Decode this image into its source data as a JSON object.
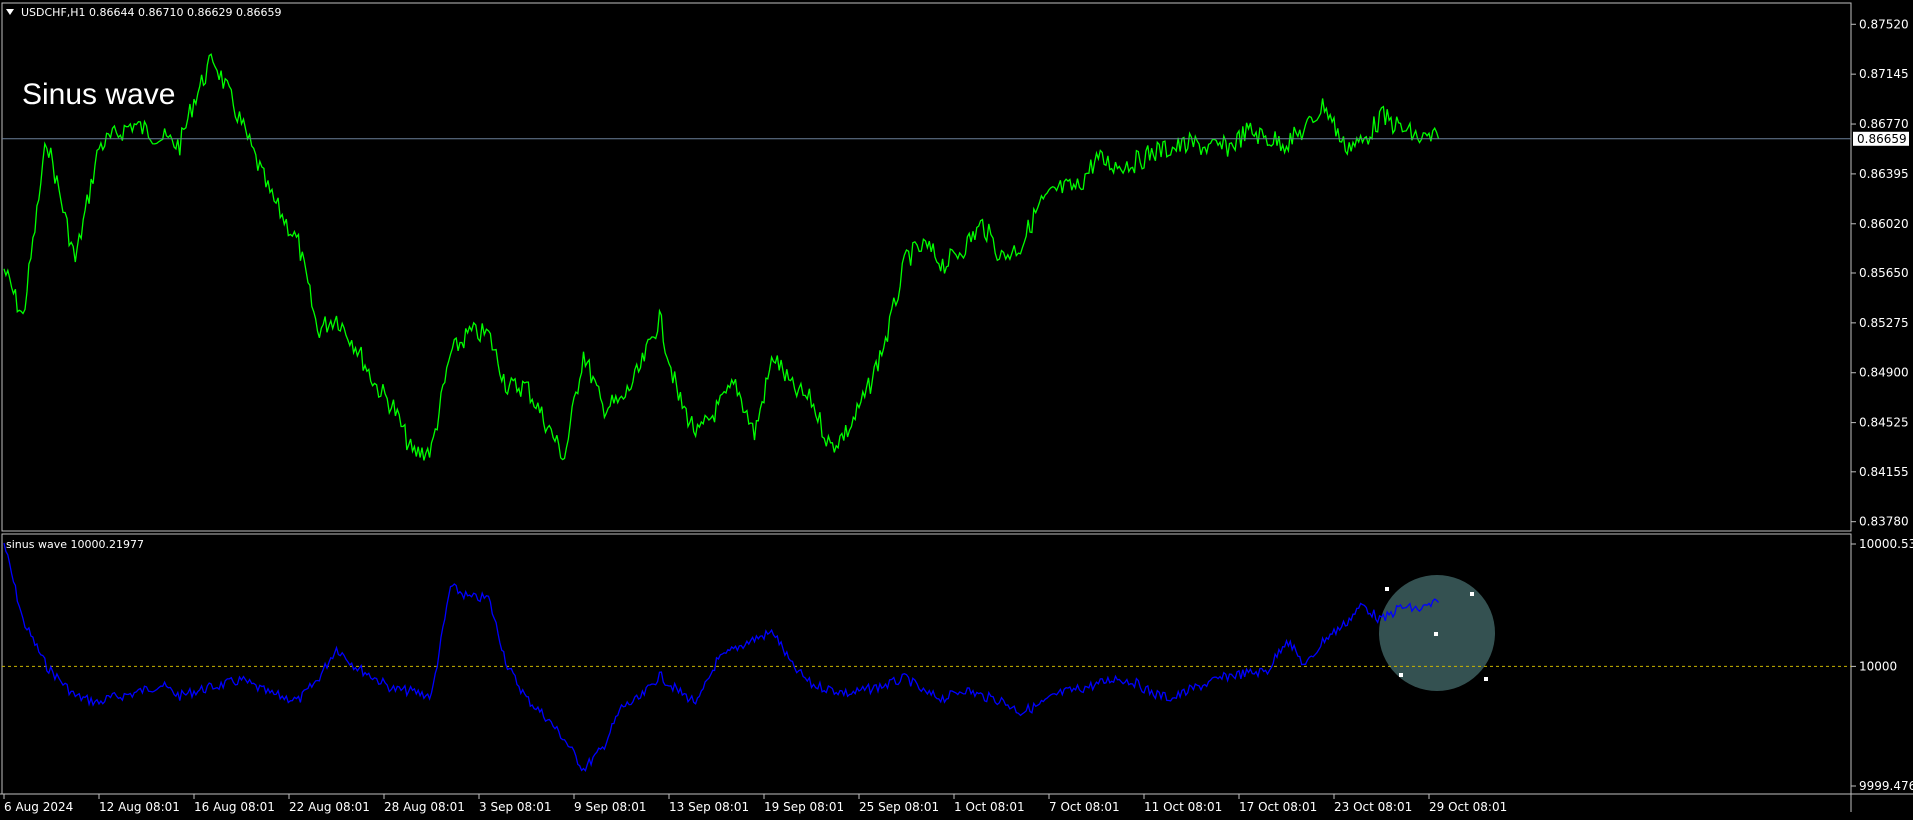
{
  "header": {
    "symbol_line": "USDCHF,H1  0.86644 0.86710 0.86629 0.86659",
    "arrow_icon": "triangle-down-icon"
  },
  "annotation_text": "Sinus wave",
  "current_price_label": "0.86659",
  "indicator": {
    "label": "sinus wave 10000.21977",
    "color": "#0000ff",
    "level_color": "#c8b400",
    "highlight_color": "#3a5a5a"
  },
  "colors": {
    "price": "#00ff00",
    "background": "#000000",
    "text": "#ffffff",
    "priceline": "#6a7f99"
  },
  "chart_data": [
    {
      "type": "line",
      "title": "USDCHF,H1",
      "y_ticks": [
        "0.87520",
        "0.87145",
        "0.86770",
        "0.86395",
        "0.86020",
        "0.85650",
        "0.85275",
        "0.84900",
        "0.84525",
        "0.84155",
        "0.83780"
      ],
      "ylim": [
        0.8371,
        0.8768
      ],
      "x_labels": [
        "6 Aug 2024",
        "12 Aug 08:01",
        "16 Aug 08:01",
        "22 Aug 08:01",
        "28 Aug 08:01",
        "3 Sep 08:01",
        "9 Sep 08:01",
        "13 Sep 08:01",
        "19 Sep 08:01",
        "25 Sep 08:01",
        "1 Oct 08:01",
        "7 Oct 08:01",
        "11 Oct 08:01",
        "17 Oct 08:01",
        "23 Oct 08:01",
        "29 Oct 08:01"
      ],
      "series": [
        {
          "x": [
            0,
            0.2,
            0.45,
            0.75,
            1.0,
            1.1,
            1.35,
            1.65,
            1.85,
            2.0,
            2.2,
            2.5,
            2.8,
            3.1,
            3.3,
            3.5,
            3.7,
            3.9,
            4.1,
            4.3,
            4.5,
            4.7,
            4.9,
            5.1,
            5.3,
            5.5,
            5.7,
            5.9,
            6.1,
            6.3,
            6.5,
            6.7,
            6.9,
            7.1,
            7.3,
            7.5,
            7.7,
            7.9,
            8.1,
            8.3,
            8.5,
            8.7,
            8.9,
            9.1,
            9.3,
            9.5,
            9.7,
            9.9,
            10.1,
            10.3,
            10.5,
            10.7,
            10.9,
            11.1,
            11.3,
            11.5,
            11.7,
            11.9,
            12.1,
            12.3,
            12.5,
            12.7,
            12.9,
            13.1,
            13.3,
            13.5,
            13.7,
            13.9,
            14.1,
            14.3,
            14.5,
            14.7,
            14.9,
            15.1
          ],
          "values": [
            0.8568,
            0.8531,
            0.8666,
            0.8574,
            0.866,
            0.8665,
            0.8677,
            0.8667,
            0.8661,
            0.8695,
            0.8727,
            0.8677,
            0.8624,
            0.8587,
            0.8522,
            0.8532,
            0.8511,
            0.8482,
            0.8464,
            0.8429,
            0.8432,
            0.8504,
            0.852,
            0.8519,
            0.8479,
            0.848,
            0.8453,
            0.8426,
            0.8505,
            0.8464,
            0.8468,
            0.8493,
            0.8531,
            0.8471,
            0.8443,
            0.8462,
            0.8482,
            0.8444,
            0.8503,
            0.8478,
            0.8469,
            0.8434,
            0.8448,
            0.8478,
            0.8519,
            0.8577,
            0.8585,
            0.8571,
            0.8584,
            0.8602,
            0.8577,
            0.8585,
            0.8616,
            0.8628,
            0.8629,
            0.8651,
            0.8646,
            0.8648,
            0.8656,
            0.8659,
            0.8662,
            0.8659,
            0.866,
            0.8672,
            0.8666,
            0.8663,
            0.8673,
            0.8692,
            0.8661,
            0.8663,
            0.8683,
            0.8674,
            0.8666,
            0.8666
          ]
        }
      ]
    },
    {
      "type": "line",
      "title": "sinus wave 10000.21977",
      "y_ticks": [
        "10000.536",
        "10000",
        "9999.4761"
      ],
      "ylim": [
        9999.4761,
        10000.536
      ],
      "series": [
        {
          "x": [
            0,
            0.2,
            0.45,
            0.75,
            1.0,
            1.1,
            1.35,
            1.65,
            1.85,
            2.0,
            2.2,
            2.5,
            2.8,
            3.1,
            3.3,
            3.5,
            3.7,
            3.9,
            4.1,
            4.3,
            4.5,
            4.7,
            4.9,
            5.1,
            5.3,
            5.5,
            5.7,
            5.9,
            6.1,
            6.3,
            6.5,
            6.7,
            6.9,
            7.1,
            7.3,
            7.5,
            7.7,
            7.9,
            8.1,
            8.3,
            8.5,
            8.7,
            8.9,
            9.1,
            9.3,
            9.5,
            9.7,
            9.9,
            10.1,
            10.3,
            10.5,
            10.7,
            10.9,
            11.1,
            11.3,
            11.5,
            11.7,
            11.9,
            12.1,
            12.3,
            12.5,
            12.7,
            12.9,
            13.1,
            13.3,
            13.5,
            13.7,
            13.9,
            14.1,
            14.3,
            14.5,
            14.7,
            14.9,
            15.1
          ],
          "values": [
            10000.54,
            10000.2,
            10000.0,
            9999.87,
            9999.84,
            9999.86,
            9999.88,
            9999.92,
            9999.87,
            9999.89,
            9999.91,
            9999.94,
            9999.88,
            9999.85,
            9999.94,
            10000.08,
            10000.0,
            9999.95,
            9999.9,
            9999.89,
            9999.87,
            10000.35,
            10000.3,
            10000.3,
            10000.0,
            9999.86,
            9999.78,
            9999.68,
            9999.55,
            9999.64,
            9999.82,
            9999.86,
            9999.96,
            9999.89,
            9999.84,
            10000.02,
            10000.08,
            10000.12,
            10000.15,
            10000.0,
            9999.92,
            9999.9,
            9999.88,
            9999.9,
            9999.92,
            9999.95,
            9999.88,
            9999.86,
            9999.9,
            9999.87,
            9999.85,
            9999.8,
            9999.83,
            9999.88,
            9999.9,
            9999.92,
            9999.95,
            9999.93,
            9999.88,
            9999.86,
            9999.9,
            9999.93,
            9999.96,
            9999.97,
            9999.98,
            10000.12,
            10000.0,
            10000.12,
            10000.18,
            10000.27,
            10000.2,
            10000.26,
            10000.25,
            10000.28
          ]
        }
      ]
    }
  ]
}
